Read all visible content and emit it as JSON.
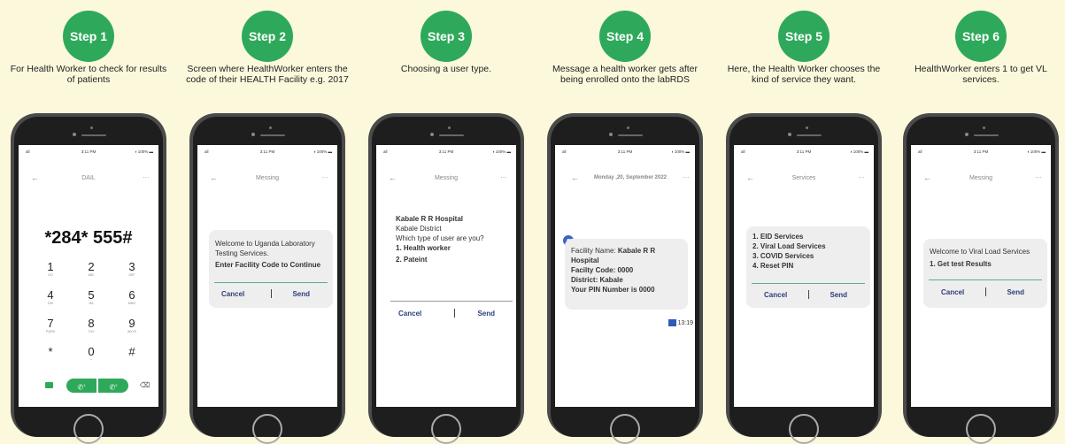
{
  "steps": [
    {
      "label": "Step 1",
      "desc": "For Health Worker to check for results of patients"
    },
    {
      "label": "Step 2",
      "desc": "Screen where HealthWorker enters the code of their HEALTH Facility e.g. 2017"
    },
    {
      "label": "Step 3",
      "desc": "Choosing a user type."
    },
    {
      "label": "Step 4",
      "desc": "Message a health worker gets after being enrolled onto the labRDS"
    },
    {
      "label": "Step 5",
      "desc": "Here, the Health Worker chooses the kind of service they want."
    },
    {
      "label": "Step 6",
      "desc": "HealthWorker enters 1 to get VL services."
    }
  ],
  "status": {
    "time": "3:11 PM",
    "battery": "100%",
    "signal": "all"
  },
  "colors": {
    "accent": "#2ea95b",
    "background": "#fbf8dc",
    "button_text": "#2c3e7a"
  },
  "icons": [
    "back-arrow-icon",
    "more-icon",
    "video-call-icon",
    "call-sim1-icon",
    "call-sim2-icon",
    "backspace-icon",
    "user-avatar-icon",
    "message-status-icon"
  ],
  "s1": {
    "title": "DAIL",
    "number": "*284* 555#",
    "keys": [
      {
        "n": "1",
        "s": "OO"
      },
      {
        "n": "2",
        "s": "ABC"
      },
      {
        "n": "3",
        "s": "DEF"
      },
      {
        "n": "4",
        "s": "GHI"
      },
      {
        "n": "5",
        "s": "JKL"
      },
      {
        "n": "6",
        "s": "MNO"
      },
      {
        "n": "7",
        "s": "PQRS"
      },
      {
        "n": "8",
        "s": "TUV"
      },
      {
        "n": "9",
        "s": "WXYZ"
      },
      {
        "n": "*",
        "s": ""
      },
      {
        "n": "0",
        "s": "+"
      },
      {
        "n": "#",
        "s": ""
      }
    ],
    "call1": "1",
    "call2": "2"
  },
  "s2": {
    "title": "Messing",
    "l1": "Welcome to  Uganda Laboratory",
    "l2": "Testing Services.",
    "l3": "Enter Facility Code to Continue",
    "cancel": "Cancel",
    "send": "Send"
  },
  "s3": {
    "title": "Messing",
    "l1": "Kabale R R Hospital",
    "l2": "Kabale District",
    "l3": "Which type of user are you?",
    "l4": "1. Health worker",
    "l5": "2. Pateint",
    "cancel": "Cancel",
    "send": "Send"
  },
  "s4": {
    "title": "Monday ,20, September 2022",
    "l1a": "Facility Name: ",
    "l1b": "Kabale R R",
    "l2": "Hospital",
    "l3": "Facilty Code: 0000",
    "l4": "District: Kabale",
    "l5": "Your PIN Number is 0000",
    "time": "13:19"
  },
  "s5": {
    "title": "Services",
    "l1": "1. EID Services",
    "l2": "2. Viral Load Services",
    "l3": "3. COVID Services",
    "l4": "4. Reset PIN",
    "cancel": "Cancel",
    "send": "Send"
  },
  "s6": {
    "title": "Messing",
    "l1": "Welcome to Viral Load Services",
    "l2": "1. Get test Results",
    "cancel": "Cancel",
    "send": "Send"
  }
}
